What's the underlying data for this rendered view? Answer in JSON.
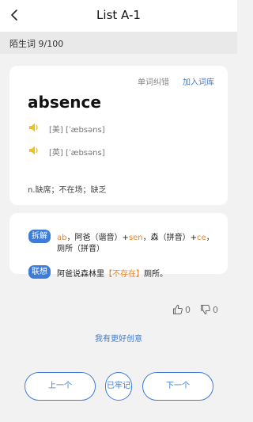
{
  "header": {
    "title": "List A-1",
    "back_icon": "chevron-left-icon"
  },
  "progress": {
    "label": "陌生词",
    "count": "9/100"
  },
  "word_card": {
    "report_label": "单词纠错",
    "add_label": "加入词库",
    "word": "absence",
    "phonetic_us": "[美] [ˈæbsəns]",
    "phonetic_uk": "[英] [ˈæbsəns]",
    "meaning": "n.缺席；不在场；缺乏",
    "speaker_color": "#f0c020"
  },
  "mnemonic": {
    "split_tag": "拆解",
    "split_parts": [
      "ab",
      "，阿爸（谐音）+",
      "sen",
      "，森（拼音）+",
      "ce",
      "，"
    ],
    "split_line2": "厕所（拼音）",
    "assoc_tag": "联想",
    "assoc_before": "阿爸说森林里",
    "assoc_highlight": "【不存在】",
    "assoc_after": "厕所。",
    "highlight_color": "#e8842e"
  },
  "votes": {
    "up": "0",
    "down": "0"
  },
  "better_idea": "我有更好创意",
  "buttons": {
    "prev": "上一个",
    "known": "已牢记",
    "next": "下一个"
  },
  "colors": {
    "accent": "#3e7cd6",
    "background": "#f2f2f2"
  }
}
